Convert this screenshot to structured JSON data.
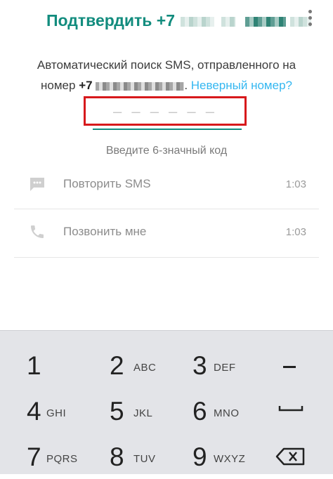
{
  "header": {
    "title": "Подтвердить +7",
    "menu_icon": "more-vert-icon",
    "accent": "#128c7e"
  },
  "info": {
    "line1": "Автоматический поиск SMS, отправленного на",
    "line2_prefix": "номер",
    "phone_prefix": "+7",
    "period": ".",
    "wrong_number_link": "Неверный номер?"
  },
  "code": {
    "placeholder": "– – –   – – –",
    "hint": "Введите 6-значный код"
  },
  "options": [
    {
      "icon": "message-icon",
      "label": "Повторить SMS",
      "time": "1:03"
    },
    {
      "icon": "phone-icon",
      "label": "Позвонить мне",
      "time": "1:03"
    }
  ],
  "keypad": {
    "keys": [
      {
        "digit": "1",
        "letters": ""
      },
      {
        "digit": "2",
        "letters": "ABC"
      },
      {
        "digit": "3",
        "letters": "DEF"
      },
      {
        "digit": "4",
        "letters": "GHI"
      },
      {
        "digit": "5",
        "letters": "JKL"
      },
      {
        "digit": "6",
        "letters": "MNO"
      },
      {
        "digit": "7",
        "letters": "PQRS"
      },
      {
        "digit": "8",
        "letters": "TUV"
      },
      {
        "digit": "9",
        "letters": "WXYZ"
      }
    ],
    "side_keys": [
      "minus-key",
      "space-key",
      "backspace-icon"
    ]
  }
}
